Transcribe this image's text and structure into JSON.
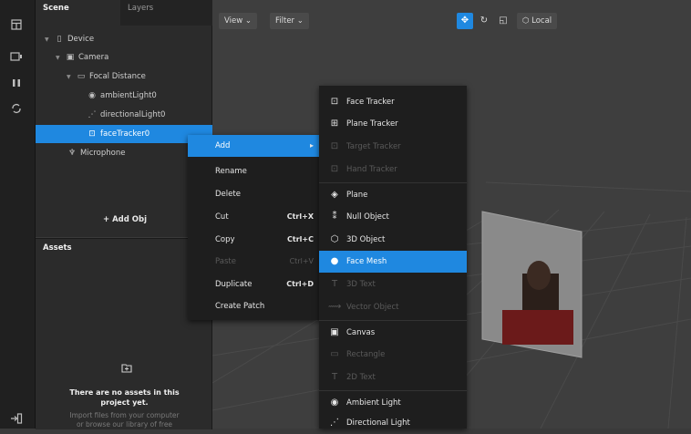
{
  "toolbar": {
    "icons": [
      "layout-icon",
      "device-icon",
      "pause-icon",
      "sync-icon"
    ],
    "bottom_icon": "exit-icon"
  },
  "scene": {
    "tab_scene": "Scene",
    "tab_layers": "Layers",
    "tree": [
      {
        "label": "Device",
        "icon": "device-icon"
      },
      {
        "label": "Camera",
        "icon": "camera-icon"
      },
      {
        "label": "Focal Distance",
        "icon": "focal-icon"
      },
      {
        "label": "ambientLight0",
        "icon": "ambient-light-icon"
      },
      {
        "label": "directionalLight0",
        "icon": "directional-light-icon"
      },
      {
        "label": "faceTracker0",
        "icon": "face-tracker-icon"
      },
      {
        "label": "Microphone",
        "icon": "microphone-icon"
      }
    ],
    "add_object": "+ Add Obj"
  },
  "assets": {
    "title": "Assets",
    "empty_line1": "There are no assets in this",
    "empty_line2": "project yet.",
    "hint_line1": "Import files from your computer",
    "hint_line2": "or browse our library of free"
  },
  "viewport": {
    "view_label": "View",
    "filter_label": "Filter",
    "local_label": "Local"
  },
  "context_menu": {
    "items": [
      {
        "label": "Add",
        "shortcut": "",
        "disabled": false,
        "highlighted": true,
        "submenu": true
      },
      {
        "label": "Rename",
        "shortcut": "",
        "disabled": false
      },
      {
        "label": "Delete",
        "shortcut": "",
        "disabled": false
      },
      {
        "label": "Cut",
        "shortcut": "Ctrl+X",
        "disabled": false
      },
      {
        "label": "Copy",
        "shortcut": "Ctrl+C",
        "disabled": false
      },
      {
        "label": "Paste",
        "shortcut": "Ctrl+V",
        "disabled": true
      },
      {
        "label": "Duplicate",
        "shortcut": "Ctrl+D",
        "disabled": false
      },
      {
        "label": "Create Patch",
        "shortcut": "",
        "disabled": false
      }
    ]
  },
  "add_submenu": {
    "items": [
      {
        "label": "Face Tracker",
        "icon": "face-tracker-icon",
        "disabled": false
      },
      {
        "label": "Plane Tracker",
        "icon": "plane-tracker-icon",
        "disabled": false
      },
      {
        "label": "Target Tracker",
        "icon": "target-tracker-icon",
        "disabled": true
      },
      {
        "label": "Hand Tracker",
        "icon": "hand-tracker-icon",
        "disabled": true
      },
      {
        "label": "Plane",
        "icon": "plane-icon",
        "disabled": false
      },
      {
        "label": "Null Object",
        "icon": "null-object-icon",
        "disabled": false
      },
      {
        "label": "3D Object",
        "icon": "3d-object-icon",
        "disabled": false
      },
      {
        "label": "Face Mesh",
        "icon": "face-mesh-icon",
        "disabled": false,
        "highlighted": true
      },
      {
        "label": "3D Text",
        "icon": "3d-text-icon",
        "disabled": true
      },
      {
        "label": "Vector Object",
        "icon": "vector-object-icon",
        "disabled": true
      },
      {
        "label": "Canvas",
        "icon": "canvas-icon",
        "disabled": false
      },
      {
        "label": "Rectangle",
        "icon": "rectangle-icon",
        "disabled": true
      },
      {
        "label": "2D Text",
        "icon": "2d-text-icon",
        "disabled": true
      },
      {
        "label": "Ambient Light",
        "icon": "ambient-light-icon",
        "disabled": false
      },
      {
        "label": "Directional Light",
        "icon": "directional-light-icon",
        "disabled": false
      }
    ]
  },
  "colors": {
    "accent": "#1f88e0",
    "menu_bg": "#1e1e1e",
    "panel_bg": "#2b2b2b",
    "viewport_bg": "#3e3e3e"
  }
}
